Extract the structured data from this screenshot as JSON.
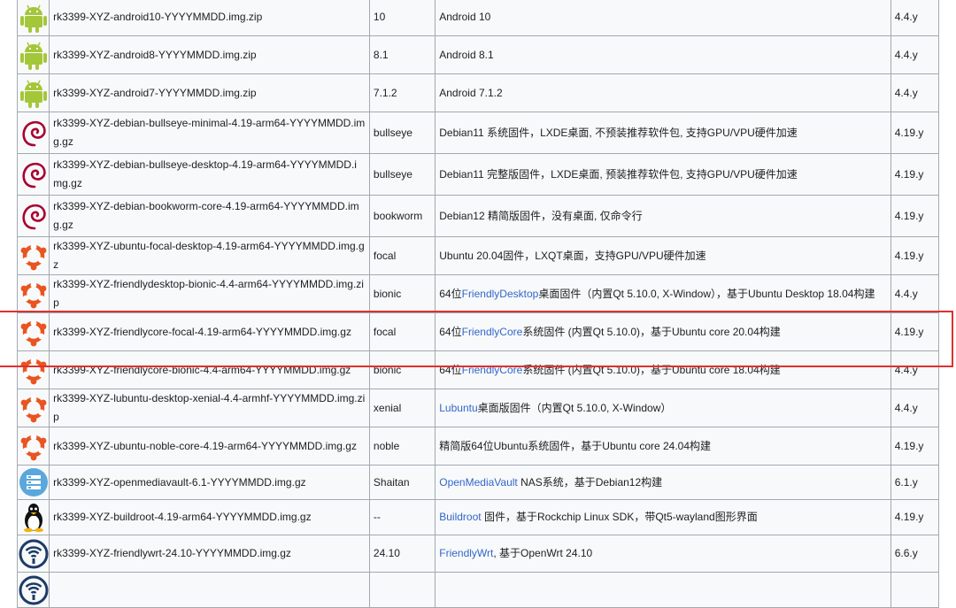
{
  "rows": [
    {
      "icon": "android-icon",
      "file": "rk3399-XYZ-android10-YYYYMMDD.img.zip",
      "code": "10",
      "desc_pre": "Android 10",
      "desc_link": "",
      "desc_post": "",
      "kernel": "4.4.y"
    },
    {
      "icon": "android-icon",
      "file": "rk3399-XYZ-android8-YYYYMMDD.img.zip",
      "code": "8.1",
      "desc_pre": "Android 8.1",
      "desc_link": "",
      "desc_post": "",
      "kernel": "4.4.y"
    },
    {
      "icon": "android-icon",
      "file": "rk3399-XYZ-android7-YYYYMMDD.img.zip",
      "code": "7.1.2",
      "desc_pre": "Android 7.1.2",
      "desc_link": "",
      "desc_post": "",
      "kernel": "4.4.y"
    },
    {
      "icon": "debian-icon",
      "file": "rk3399-XYZ-debian-bullseye-minimal-4.19-arm64-YYYYMMDD.img.gz",
      "code": "bullseye",
      "desc_pre": "Debian11 系统固件，LXDE桌面, 不预装推荐软件包, 支持GPU/VPU硬件加速",
      "desc_link": "",
      "desc_post": "",
      "kernel": "4.19.y"
    },
    {
      "icon": "debian-icon",
      "file": "rk3399-XYZ-debian-bullseye-desktop-4.19-arm64-YYYYMMDD.img.gz",
      "code": "bullseye",
      "desc_pre": "Debian11 完整版固件，LXDE桌面, 预装推荐软件包, 支持GPU/VPU硬件加速",
      "desc_link": "",
      "desc_post": "",
      "kernel": "4.19.y"
    },
    {
      "icon": "debian-icon",
      "file": "rk3399-XYZ-debian-bookworm-core-4.19-arm64-YYYYMMDD.img.gz",
      "code": "bookworm",
      "desc_pre": "Debian12 精简版固件，没有桌面, 仅命令行",
      "desc_link": "",
      "desc_post": "",
      "kernel": "4.19.y"
    },
    {
      "icon": "ubuntu-icon",
      "file": "rk3399-XYZ-ubuntu-focal-desktop-4.19-arm64-YYYYMMDD.img.gz",
      "code": "focal",
      "desc_pre": "Ubuntu 20.04固件，LXQT桌面，支持GPU/VPU硬件加速",
      "desc_link": "",
      "desc_post": "",
      "kernel": "4.19.y"
    },
    {
      "icon": "ubuntu-icon",
      "file": "rk3399-XYZ-friendlydesktop-bionic-4.4-arm64-YYYYMMDD.img.zip",
      "code": "bionic",
      "desc_pre": "64位",
      "desc_link": "FriendlyDesktop",
      "desc_post": "桌面固件（内置Qt 5.10.0, X-Window），基于Ubuntu Desktop 18.04构建",
      "kernel": "4.4.y"
    },
    {
      "icon": "ubuntu-icon",
      "file": "rk3399-XYZ-friendlycore-focal-4.19-arm64-YYYYMMDD.img.gz",
      "code": "focal",
      "desc_pre": "64位",
      "desc_link": "FriendlyCore",
      "desc_post": "系统固件 (内置Qt 5.10.0)，基于Ubuntu core 20.04构建",
      "kernel": "4.19.y"
    },
    {
      "icon": "ubuntu-icon",
      "file": "rk3399-XYZ-friendlycore-bionic-4.4-arm64-YYYYMMDD.img.gz",
      "code": "bionic",
      "desc_pre": "64位",
      "desc_link": "FriendlyCore",
      "desc_post": "系统固件 (内置Qt 5.10.0)，基于Ubuntu core 18.04构建",
      "kernel": "4.4.y"
    },
    {
      "icon": "ubuntu-icon",
      "file": "rk3399-XYZ-lubuntu-desktop-xenial-4.4-armhf-YYYYMMDD.img.zip",
      "code": "xenial",
      "desc_pre": "",
      "desc_link": "Lubuntu",
      "desc_post": "桌面版固件（内置Qt 5.10.0, X-Window）",
      "kernel": "4.4.y"
    },
    {
      "icon": "ubuntu-icon",
      "file": "rk3399-XYZ-ubuntu-noble-core-4.19-arm64-YYYYMMDD.img.gz",
      "code": "noble",
      "desc_pre": "精简版64位Ubuntu系统固件，基于Ubuntu core 24.04构建",
      "desc_link": "",
      "desc_post": "",
      "kernel": "4.19.y"
    },
    {
      "icon": "openmediavault-icon",
      "file": "rk3399-XYZ-openmediavault-6.1-YYYYMMDD.img.gz",
      "code": "Shaitan",
      "desc_pre": "",
      "desc_link": "OpenMediaVault",
      "desc_post": " NAS系统，基于Debian12构建",
      "kernel": "6.1.y"
    },
    {
      "icon": "tux-icon",
      "file": "rk3399-XYZ-buildroot-4.19-arm64-YYYYMMDD.img.gz",
      "code": "--",
      "desc_pre": "",
      "desc_link": "Buildroot",
      "desc_post": " 固件，基于Rockchip Linux SDK，带Qt5-wayland图形界面",
      "kernel": "4.19.y"
    },
    {
      "icon": "friendlywrt-icon",
      "file": "rk3399-XYZ-friendlywrt-24.10-YYYYMMDD.img.gz",
      "code": "24.10",
      "desc_pre": "",
      "desc_link": "FriendlyWrt",
      "desc_post": ", 基于OpenWrt 24.10",
      "kernel": "6.6.y"
    },
    {
      "icon": "friendlywrt-icon",
      "file": "",
      "code": "",
      "desc_pre": "",
      "desc_link": "",
      "desc_post": "",
      "kernel": ""
    }
  ],
  "colors": {
    "android": "#a4c639",
    "debian": "#a80030",
    "ubuntu": "#e95420",
    "link": "#3366cc",
    "highlight": "#e0302f",
    "omv": "#5aa7dc",
    "wrt": "#1c3b67"
  }
}
